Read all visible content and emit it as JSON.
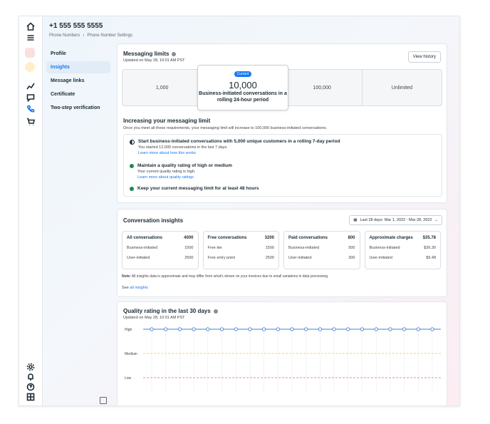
{
  "header": {
    "phone": "+1 555 555 5555",
    "breadcrumb": [
      "Phone Numbers",
      "Phone Number Settings"
    ]
  },
  "subnav": [
    "Profile",
    "Insights",
    "Message links",
    "Certificate",
    "Two-step verification"
  ],
  "subnav_active": 1,
  "messaging": {
    "title": "Messaging limits",
    "updated": "Updated on May 28, 10:01 AM PST",
    "view_history": "View history",
    "tiers": [
      "1,000",
      "10,000",
      "100,000",
      "Unlimited"
    ],
    "current_badge": "Current",
    "current_value": "10,000",
    "current_desc": "Business-initiated conversations in a rolling 24-hour period",
    "increase_title": "Increasing your messaging limit",
    "increase_sub": "Once you meet all these requirements, your messaging limit will increase to 100,000 business-initiated conversations.",
    "requirements": [
      {
        "status": "in-progress",
        "title": "Start business-initiated conversations with 5,000 unique customers in a rolling 7-day period",
        "detail": "You started 12,000 conversations in the last 7 days.",
        "link": "Learn more about how this works"
      },
      {
        "status": "done",
        "title": "Maintain a quality rating of high or medium",
        "detail": "Your current quality rating is high.",
        "link": "Learn more about quality ratings"
      },
      {
        "status": "done",
        "title": "Keep your current messaging limit for at least 48 hours",
        "detail": "",
        "link": ""
      }
    ]
  },
  "insights": {
    "title": "Conversation insights",
    "date_range": "Last 28 days: Mar 1, 2022 - Mar 28, 2022",
    "boxes": [
      {
        "label": "All conversations",
        "total": "4000",
        "rows": [
          [
            "Business-initiated",
            "1500"
          ],
          [
            "User-initiated",
            "2500"
          ]
        ]
      },
      {
        "label": "Free conversations",
        "total": "3200",
        "rows": [
          [
            "Free tier",
            "1500"
          ],
          [
            "Free entry point",
            "2500"
          ]
        ]
      },
      {
        "label": "Paid conversations",
        "total": "800",
        "rows": [
          [
            "Business-initiated",
            "500"
          ],
          [
            "User-initiated",
            "300"
          ]
        ]
      },
      {
        "label": "Approximate charges",
        "total": "$35.78",
        "rows": [
          [
            "Business-initiated",
            "$26.30"
          ],
          [
            "User-initiated",
            "$9.48"
          ]
        ]
      }
    ],
    "note_bold": "Note:",
    "note": " All insights data is approximate and may differ from what's shown on your invoices due to small variations in data processing.",
    "see_prefix": "See ",
    "see_link": "all insights"
  },
  "quality": {
    "title": "Quality rating in the last 30 days",
    "updated": "Updated on May 28, 10:01 AM PST"
  },
  "chart_data": {
    "type": "line",
    "categories": [
      "High",
      "Medium",
      "Low"
    ],
    "series": [
      {
        "values": [
          "High",
          "High",
          "High",
          "High",
          "High",
          "High",
          "High",
          "High",
          "High",
          "High",
          "High",
          "High",
          "High",
          "High",
          "High",
          "High",
          "High",
          "High",
          "High",
          "High",
          "High"
        ]
      }
    ],
    "colors": {
      "high": "#4a7fd6",
      "medium": "#f2c14e",
      "low": "#e86a6a"
    },
    "grid": true
  },
  "colors": {
    "accent": "#1877f2",
    "ok": "#1e8a4c"
  }
}
